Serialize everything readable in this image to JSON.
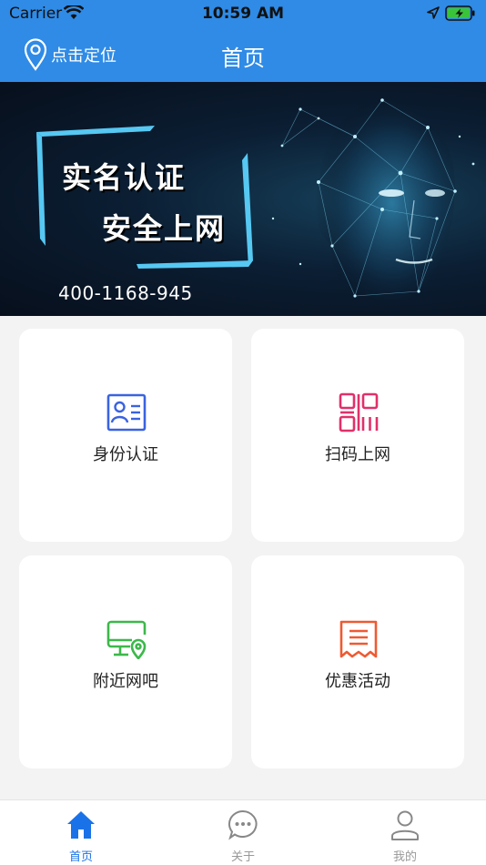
{
  "status": {
    "carrier": "Carrier",
    "time": "10:59 AM"
  },
  "navbar": {
    "location_label": "点击定位",
    "title": "首页"
  },
  "banner": {
    "line1": "实名认证",
    "line2": "安全上网",
    "phone": "400-1168-945"
  },
  "cards": [
    {
      "label": "身份认证",
      "icon": "id-card-icon",
      "color": "#3a63e0"
    },
    {
      "label": "扫码上网",
      "icon": "qr-code-icon",
      "color": "#e0306a"
    },
    {
      "label": "附近网吧",
      "icon": "monitor-location-icon",
      "color": "#3cb84a"
    },
    {
      "label": "优惠活动",
      "icon": "receipt-icon",
      "color": "#ee5a32"
    }
  ],
  "tabs": [
    {
      "label": "首页",
      "icon": "home-icon",
      "active": true
    },
    {
      "label": "关于",
      "icon": "chat-bubble-icon",
      "active": false
    },
    {
      "label": "我的",
      "icon": "user-icon",
      "active": false
    }
  ],
  "colors": {
    "primary": "#2f8be6",
    "tab_active": "#1a72e8",
    "tab_inactive": "#999999"
  }
}
